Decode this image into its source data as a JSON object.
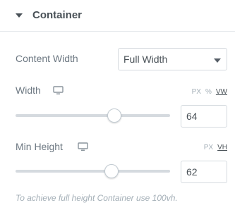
{
  "section": {
    "title": "Container"
  },
  "content_width": {
    "label": "Content Width",
    "value": "Full Width"
  },
  "width": {
    "label": "Width",
    "units": [
      "PX",
      "%",
      "VW"
    ],
    "active_unit": "VW",
    "value": "64",
    "slider_fraction": 0.64
  },
  "min_height": {
    "label": "Min Height",
    "units": [
      "PX",
      "VH"
    ],
    "active_unit": "VH",
    "value": "62",
    "slider_fraction": 0.62
  },
  "help_text": "To achieve full height Container use 100vh.",
  "icons": {
    "caret": "caret-down-icon",
    "device": "desktop-monitor-icon",
    "select_arrow": "chevron-down-icon"
  }
}
